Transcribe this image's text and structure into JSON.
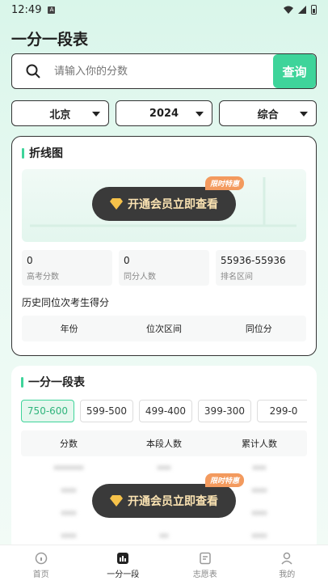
{
  "status": {
    "time": "12:49"
  },
  "page": {
    "title": "一分一段表"
  },
  "search": {
    "placeholder": "请输入你的分数",
    "button_label": "查询"
  },
  "filters": {
    "province": "北京",
    "year": "2024",
    "category": "综合"
  },
  "line_chart": {
    "title": "折线图",
    "vip_label": "开通会员立即查看",
    "vip_tag": "限时特惠",
    "stats": [
      {
        "value": "0",
        "label": "高考分数"
      },
      {
        "value": "0",
        "label": "同分人数"
      },
      {
        "value": "55936-55936",
        "label": "排名区间"
      }
    ],
    "history_title": "历史同位次考生得分",
    "history_columns": [
      "年份",
      "位次区间",
      "同位分"
    ]
  },
  "table": {
    "title": "一分一段表",
    "ranges": [
      "750-600",
      "599-500",
      "499-400",
      "399-300",
      "299-0"
    ],
    "columns": [
      "分数",
      "本段人数",
      "累计人数"
    ],
    "vip_label": "开通会员立即查看",
    "vip_tag": "限时特惠"
  },
  "nav": [
    {
      "label": "首页"
    },
    {
      "label": "一分一段"
    },
    {
      "label": "志愿表"
    },
    {
      "label": "我的"
    }
  ],
  "colors": {
    "accent": "#3ed49a",
    "vip_bg": "#3a3a3a",
    "vip_text": "#fbe3b2",
    "tag": "#f39a5e"
  }
}
